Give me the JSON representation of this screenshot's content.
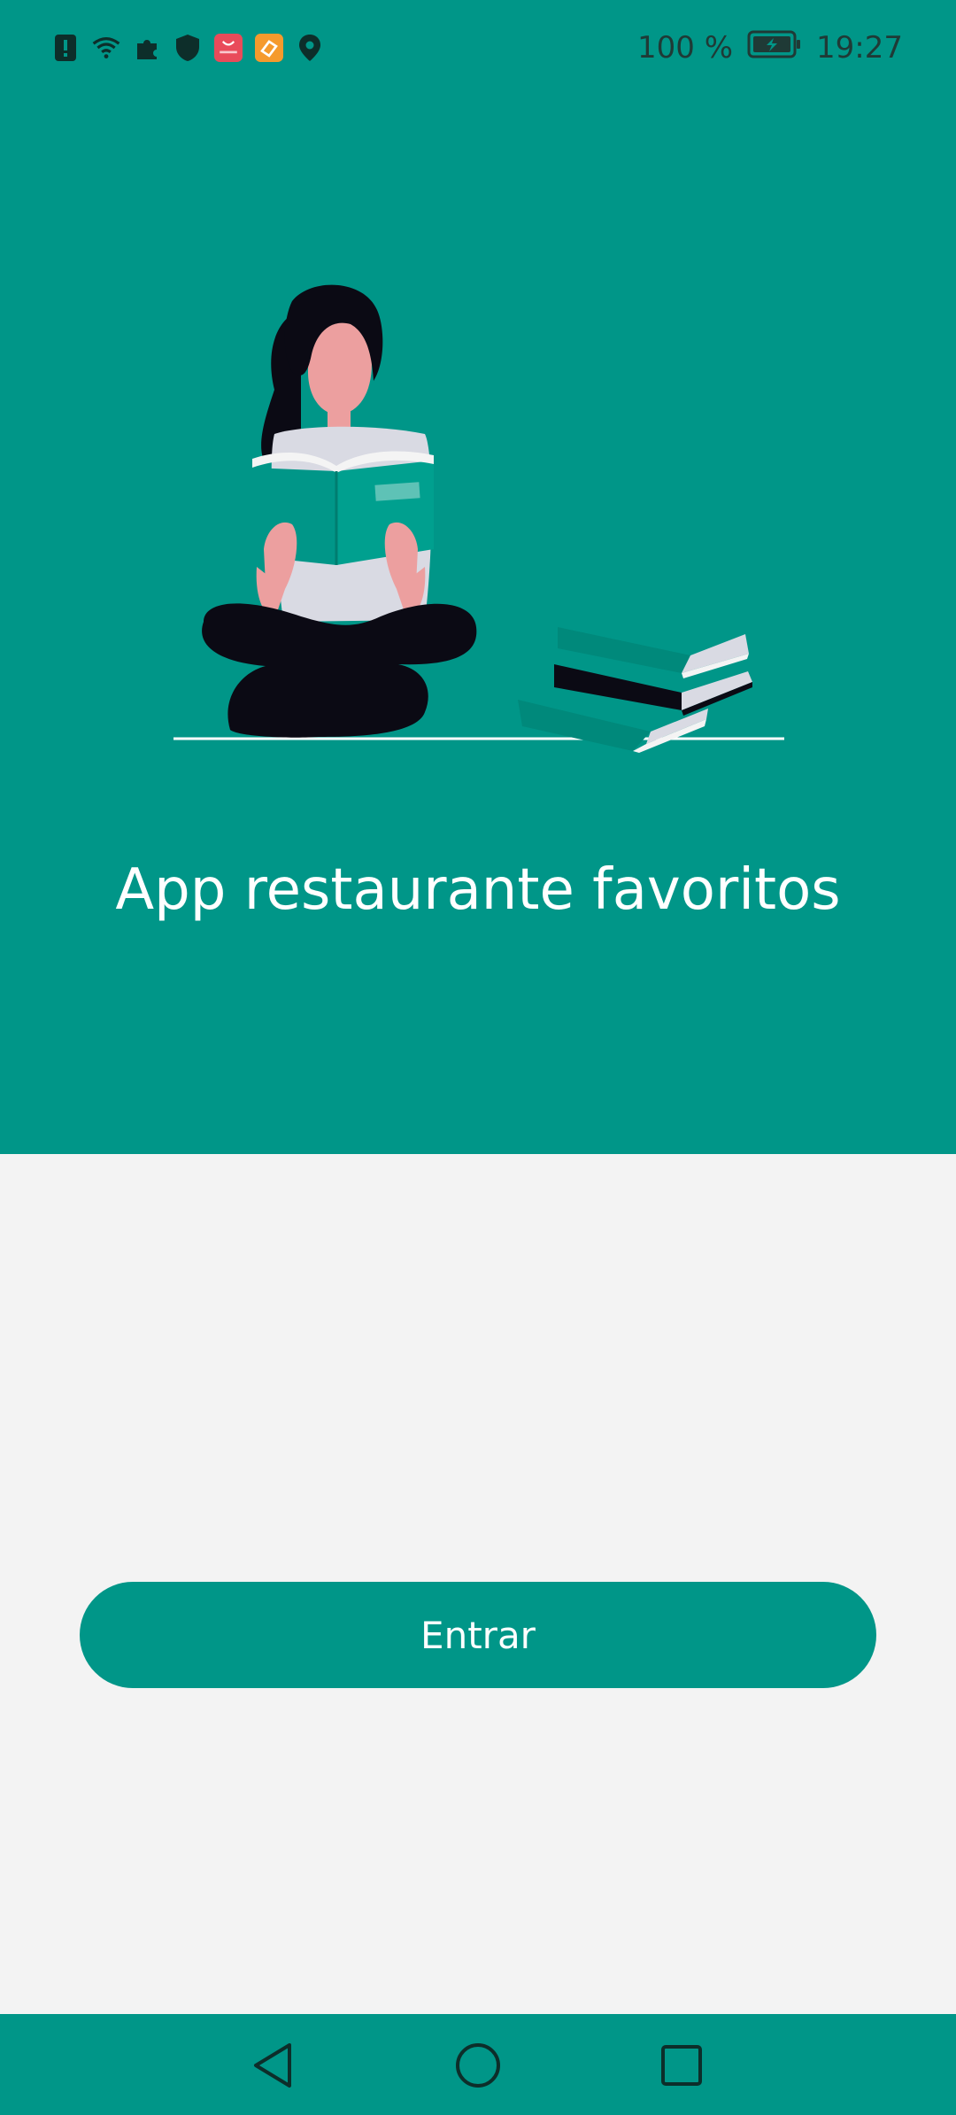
{
  "status_bar": {
    "icons": [
      "alert-icon",
      "wifi-icon",
      "puzzle-icon",
      "shield-icon",
      "huawei-store-icon",
      "health-app-icon",
      "location-icon"
    ],
    "battery_percent": "100 %",
    "time": "19:27"
  },
  "hero": {
    "title": "App restaurante favoritos",
    "illustration": "woman-reading-book-illustration"
  },
  "actions": {
    "enter_label": "Entrar"
  },
  "nav": {
    "buttons": [
      "back-icon",
      "home-icon",
      "recents-icon"
    ]
  },
  "colors": {
    "primary": "#009688",
    "background": "#f3f3f3",
    "text_on_primary": "#ffffff"
  }
}
